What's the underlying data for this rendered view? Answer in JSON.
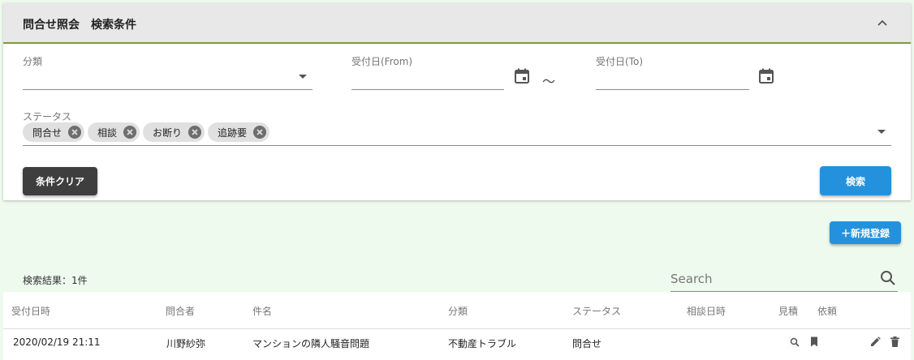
{
  "panel": {
    "title": "問合せ照会　検索条件",
    "category_label": "分類",
    "from_label": "受付日(From)",
    "to_label": "受付日(To)",
    "range_separator": "～",
    "status_label": "ステータス",
    "status_chips": [
      "問合せ",
      "相談",
      "お断り",
      "追跡要"
    ],
    "clear_button": "条件クリア",
    "search_button": "検索"
  },
  "toolbar": {
    "new_button": "＋新規登録"
  },
  "results": {
    "count_text": "検索結果：1件",
    "search_placeholder": "Search"
  },
  "table": {
    "headers": [
      "受付日時",
      "問合者",
      "件名",
      "分類",
      "ステータス",
      "相談日時",
      "見積",
      "依頼"
    ],
    "rows": [
      {
        "received_at": "2020/02/19 21:11",
        "inquirer": "川野紗弥",
        "subject": "マンションの隣人騒音問題",
        "category": "不動産トラブル",
        "status": "問合せ",
        "consult_at": ""
      }
    ]
  },
  "colors": {
    "page_bg": "#eefaee",
    "header_bg": "#e8e8e8",
    "header_border": "#7a9a44",
    "primary": "#2491dd",
    "dark_button": "#3e3e3e"
  }
}
